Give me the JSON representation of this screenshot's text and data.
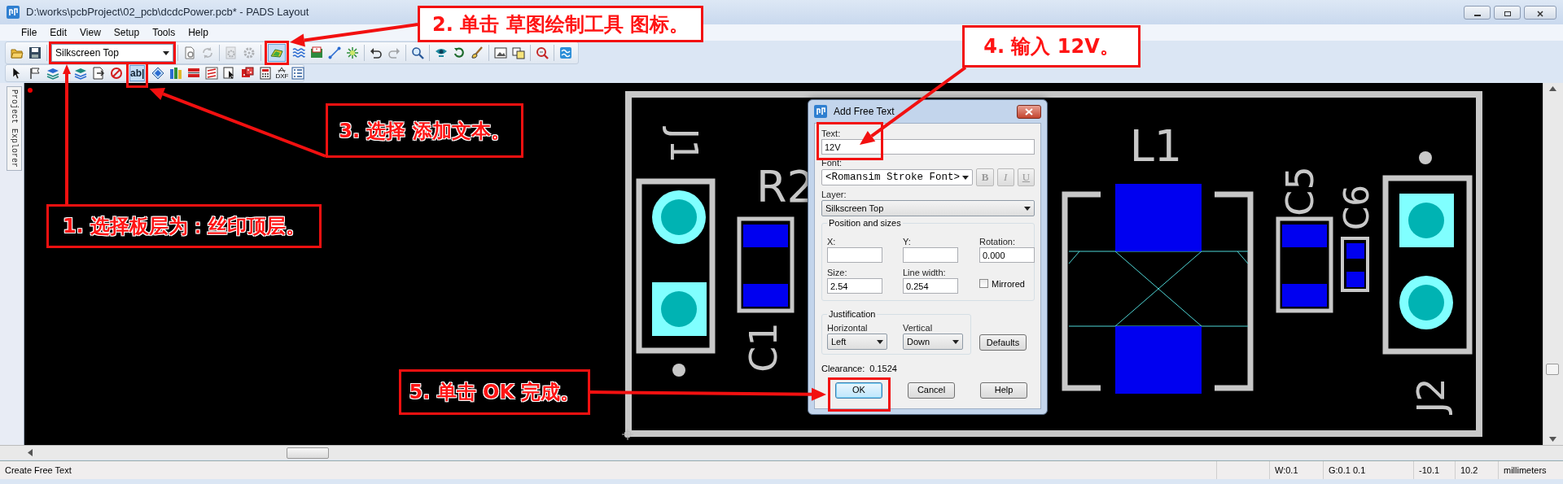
{
  "window": {
    "title": "D:\\works\\pcbProject\\02_pcb\\dcdcPower.pcb* - PADS Layout"
  },
  "menu": [
    {
      "label": "File"
    },
    {
      "label": "Edit"
    },
    {
      "label": "View"
    },
    {
      "label": "Setup"
    },
    {
      "label": "Tools"
    },
    {
      "label": "Help"
    }
  ],
  "toolbar_1": [
    {
      "kind": "folder",
      "disabled": false,
      "selected": false
    },
    {
      "kind": "save",
      "disabled": false,
      "selected": false
    },
    {
      "kind": "separator"
    },
    {
      "kind": "layer-select",
      "value": "Silkscreen Top"
    },
    {
      "kind": "separator"
    },
    {
      "kind": "properties",
      "disabled": false,
      "selected": false
    },
    {
      "kind": "refresh",
      "disabled": true,
      "selected": false
    },
    {
      "kind": "separator"
    },
    {
      "kind": "gear-doc",
      "disabled": true,
      "selected": false
    },
    {
      "kind": "gear",
      "disabled": true,
      "selected": false
    },
    {
      "kind": "separator"
    },
    {
      "kind": "sketch",
      "disabled": false,
      "selected": true
    },
    {
      "kind": "route",
      "disabled": false,
      "selected": false
    },
    {
      "kind": "board",
      "disabled": false,
      "selected": false
    },
    {
      "kind": "line",
      "disabled": false,
      "selected": false
    },
    {
      "kind": "burst",
      "disabled": false,
      "selected": false
    },
    {
      "kind": "separator"
    },
    {
      "kind": "undo",
      "disabled": false,
      "selected": false
    },
    {
      "kind": "redo",
      "disabled": true,
      "selected": false
    },
    {
      "kind": "separator"
    },
    {
      "kind": "zoom",
      "disabled": false,
      "selected": false
    },
    {
      "kind": "separator"
    },
    {
      "kind": "eye",
      "disabled": false,
      "selected": false
    },
    {
      "kind": "loop",
      "disabled": false,
      "selected": false
    },
    {
      "kind": "brush",
      "disabled": false,
      "selected": false
    },
    {
      "kind": "separator"
    },
    {
      "kind": "picture",
      "disabled": false,
      "selected": false
    },
    {
      "kind": "windows",
      "disabled": false,
      "selected": false
    },
    {
      "kind": "separator"
    },
    {
      "kind": "search-red",
      "disabled": false,
      "selected": false
    },
    {
      "kind": "separator"
    },
    {
      "kind": "flow",
      "disabled": false,
      "selected": false
    }
  ],
  "toolbar_2": [
    {
      "kind": "pointer",
      "disabled": false,
      "selected": false
    },
    {
      "kind": "flag",
      "disabled": false,
      "selected": false
    },
    {
      "kind": "layers-blue",
      "disabled": false,
      "selected": false
    },
    {
      "kind": "layers-teal",
      "disabled": false,
      "selected": false
    },
    {
      "kind": "doc-arrow",
      "disabled": false,
      "selected": false
    },
    {
      "kind": "no-entry",
      "disabled": false,
      "selected": false
    },
    {
      "kind": "text",
      "label": "ab|",
      "disabled": false,
      "selected": true
    },
    {
      "kind": "diamond",
      "disabled": false,
      "selected": false
    },
    {
      "kind": "books",
      "disabled": false,
      "selected": false
    },
    {
      "kind": "bars",
      "disabled": false,
      "selected": false
    },
    {
      "kind": "lines",
      "disabled": false,
      "selected": false
    },
    {
      "kind": "cursor",
      "disabled": false,
      "selected": false
    },
    {
      "kind": "dice",
      "disabled": false,
      "selected": false
    },
    {
      "kind": "calculator",
      "disabled": false,
      "selected": false
    },
    {
      "kind": "dxf",
      "label": "DXF",
      "disabled": false,
      "selected": false
    },
    {
      "kind": "list",
      "disabled": false,
      "selected": false
    }
  ],
  "side_tab": {
    "label": "Project Explorer"
  },
  "board": {
    "labels": [
      "J1",
      "R2",
      "C1",
      "L1",
      "C5",
      "C6",
      "J2"
    ]
  },
  "dialog": {
    "title": "Add Free Text",
    "text_field": {
      "label": "Text:",
      "value": "12V"
    },
    "font": {
      "label": "Font:",
      "value": "<Romansim Stroke Font>"
    },
    "style_buttons": [
      {
        "label": "B",
        "disabled": true
      },
      {
        "label": "I",
        "disabled": true
      },
      {
        "label": "U",
        "disabled": true
      }
    ],
    "layer": {
      "label": "Layer:",
      "value": "Silkscreen Top"
    },
    "position_group": {
      "title": "Position and sizes",
      "fields": [
        {
          "label": "X:"
        },
        {
          "label": "Y:"
        },
        {
          "label": "Rotation:",
          "value": "0.000"
        },
        {
          "label": "Size:",
          "value": "2.54"
        },
        {
          "label": "Line width:",
          "value": "0.254"
        }
      ],
      "mirrored": {
        "label": "Mirrored",
        "checked": false
      }
    },
    "justification": {
      "title": "Justification",
      "horizontal": {
        "label": "Horizontal",
        "value": "Left"
      },
      "vertical": {
        "label": "Vertical",
        "value": "Down"
      }
    },
    "defaults_button": "Defaults",
    "clearance": "Clearance:  0.1524",
    "buttons": [
      {
        "label": "OK",
        "default": true
      },
      {
        "label": "Cancel",
        "default": false
      },
      {
        "label": "Help",
        "default": false
      }
    ]
  },
  "status_bar": [
    "Create Free Text",
    "W:0.1",
    "G:0.1 0.1",
    "-10.1",
    "10.2",
    "millimeters"
  ],
  "annotations": [
    {
      "text": "1. 选择板层为：丝印顶层。"
    },
    {
      "text": "2. 单击 草图绘制工具 图标。"
    },
    {
      "text": "3. 选择 添加文本。"
    },
    {
      "text": "4. 输入 12V。"
    },
    {
      "text": "5. 单击 OK 完成。"
    }
  ]
}
